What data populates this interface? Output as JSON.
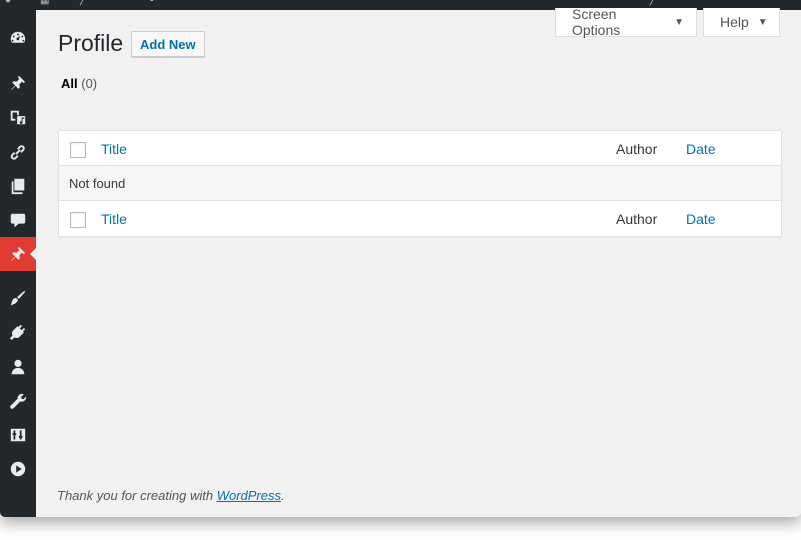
{
  "page": {
    "title": "Profile",
    "add_new_label": "Add New"
  },
  "screen_meta": {
    "screen_options_label": "Screen Options",
    "help_label": "Help",
    "caret": "▼"
  },
  "views": {
    "all_label": "All",
    "all_count": "(0)"
  },
  "table": {
    "columns": [
      "Title",
      "Author",
      "Date"
    ],
    "empty_message": "Not found"
  },
  "footer": {
    "text_before": "Thank you for creating with ",
    "link_text": "WordPress",
    "text_after": "."
  },
  "sidebar": {
    "items": [
      {
        "icon": "dashboard-icon"
      },
      {
        "icon": "posts-pin-icon"
      },
      {
        "icon": "media-icon"
      },
      {
        "icon": "links-icon"
      },
      {
        "icon": "pages-icon"
      },
      {
        "icon": "comments-icon"
      },
      {
        "icon": "profile-pin-icon",
        "current": true
      },
      {
        "icon": "appearance-brush-icon"
      },
      {
        "icon": "plugins-icon"
      },
      {
        "icon": "users-icon"
      },
      {
        "icon": "tools-wrench-icon"
      },
      {
        "icon": "settings-icon"
      },
      {
        "icon": "collapse-play-icon"
      }
    ]
  },
  "colors": {
    "sidebar_bg": "#23282d",
    "current_item_bg": "#e03c31",
    "link": "#0073aa",
    "page_bg": "#f1f1f1"
  }
}
